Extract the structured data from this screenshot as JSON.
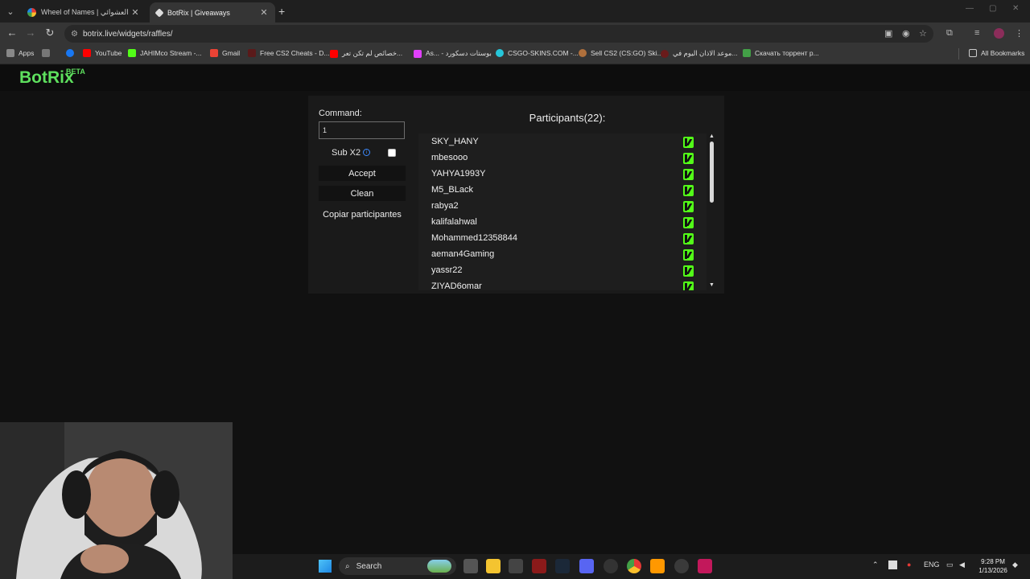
{
  "browser": {
    "tabs": [
      {
        "title": "Wheel of Names | نيم العشوائي",
        "active": false
      },
      {
        "title": "BotRix | Giveaways",
        "active": true
      }
    ],
    "url": "botrix.live/widgets/raffles/",
    "bookmarks": [
      "Apps",
      "YouTube",
      "JAHIMco Stream -...",
      "Gmail",
      "Free CS2 Cheats - D...",
      "خصائص لم تكن تعر...",
      "As... - بوستات دسكورد",
      "CSGO-SKINS.COM -...",
      "Sell CS2 (CS:GO) Ski...",
      "موعد الاذان اليوم في...",
      "Скачать торрент р...",
      "All Bookmarks"
    ]
  },
  "site": {
    "logo": "BotRix",
    "badge": "BETA"
  },
  "raffle": {
    "command_label": "Command:",
    "command_value": "1",
    "sub_label": "Sub X2",
    "sub_checked": false,
    "accept_label": "Accept",
    "clean_label": "Clean",
    "copy_label": "Copiar participantes",
    "participants_title": "Participants(22):",
    "participants": [
      "SKY_HANY",
      "mbesooo",
      "YAHYA1993Y",
      "M5_BLack",
      "rabya2",
      "kalifalahwal",
      "Mohammed12358844",
      "aeman4Gaming",
      "yassr22",
      "ZIYAD6omar"
    ]
  },
  "taskbar": {
    "search_label": "Search",
    "lang": "ENG",
    "time": "9:28 PM",
    "date": "1/13/2026"
  },
  "colors": {
    "brand": "#5ee05e",
    "kick": "#53fc18",
    "info": "#3d8bff"
  }
}
